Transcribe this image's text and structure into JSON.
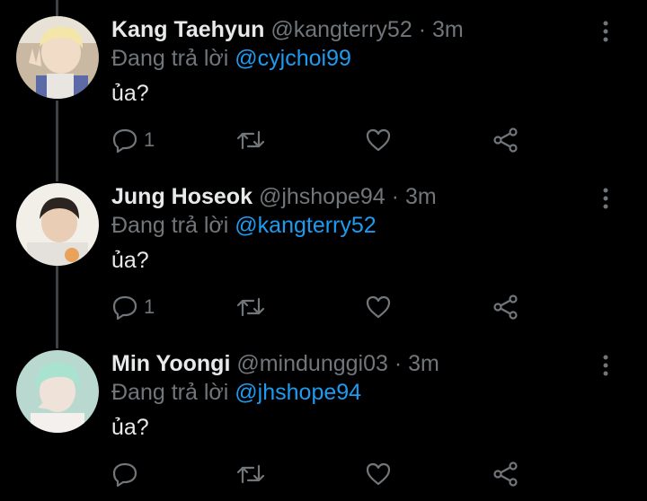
{
  "reply_prefix": "Đang trả lời",
  "tweets": [
    {
      "name": "Kang Taehyun",
      "handle": "@kangterry52",
      "time": "3m",
      "reply_to": "@cyjchoi99",
      "text": "ủa?",
      "reply_count": "1",
      "avatar_icon": "avatar-photo"
    },
    {
      "name": "Jung Hoseok",
      "handle": "@jhshope94",
      "time": "3m",
      "reply_to": "@kangterry52",
      "text": "ủa?",
      "reply_count": "1",
      "avatar_icon": "avatar-photo"
    },
    {
      "name": "Min Yoongi",
      "handle": "@mindunggi03",
      "time": "3m",
      "reply_to": "@jhshope94",
      "text": "ủa?",
      "reply_count": "",
      "avatar_icon": "avatar-photo"
    }
  ],
  "separator": "·",
  "colors": {
    "background": "#000000",
    "name": "#e7e9ea",
    "muted": "#71767b",
    "link": "#1d9bf0",
    "thread_line": "#3d4247"
  }
}
